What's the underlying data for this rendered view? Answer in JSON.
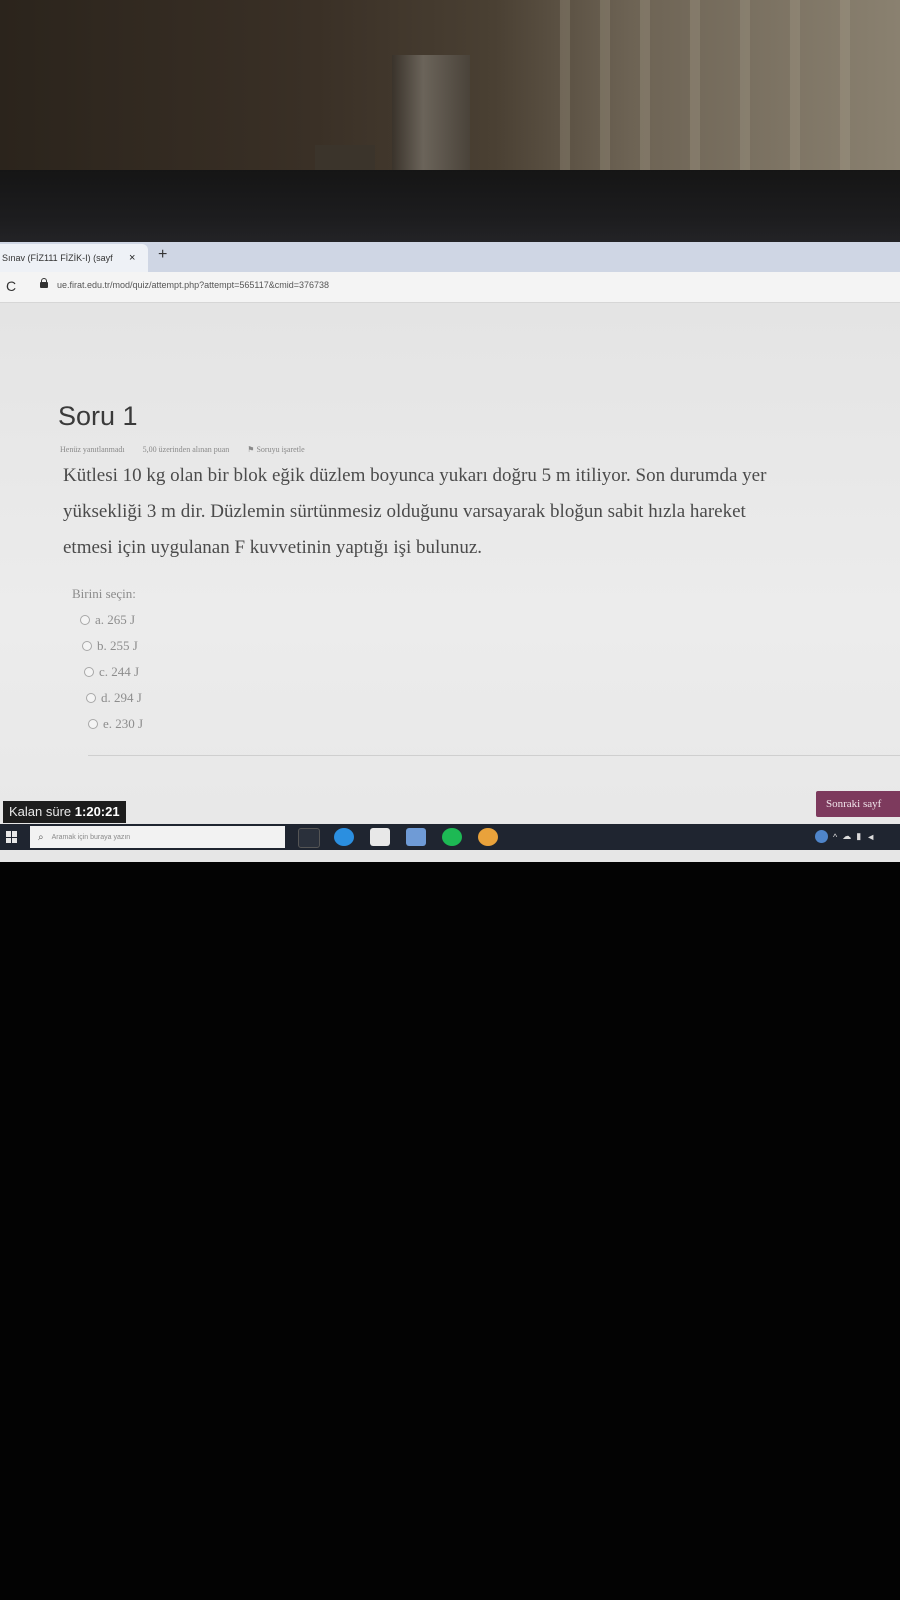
{
  "browser": {
    "tab_title": "Sınav (FİZ111 FİZİK-I) (sayf",
    "tab_close": "×",
    "new_tab": "+",
    "reload": "C",
    "url": "ue.firat.edu.tr/mod/quiz/attempt.php?attempt=565117&cmid=376738"
  },
  "question": {
    "heading": "Soru 1",
    "status": "Henüz yanıtlanmadı",
    "points": "5,00 üzerinden alınan puan",
    "flag": "Soruyu işaretle",
    "text_line1": "Kütlesi 10 kg olan bir blok eğik düzlem boyunca yukarı doğru 5 m itiliyor. Son durumda yer",
    "text_line2": "yüksekliği 3 m dir. Düzlemin sürtünmesiz olduğunu varsayarak bloğun sabit hızla hareket",
    "text_line3": "etmesi için uygulanan F kuvvetinin yaptığı işi bulunuz.",
    "choose_label": "Birini seçin:",
    "options": [
      {
        "label": "a. 265 J"
      },
      {
        "label": "b. 255 J"
      },
      {
        "label": "c. 244 J"
      },
      {
        "label": "d. 294 J"
      },
      {
        "label": "e. 230 J"
      }
    ]
  },
  "footer": {
    "timer_label": "Kalan süre",
    "timer_value": "1:20:21",
    "next_button": "Sonraki sayf"
  },
  "taskbar": {
    "search_placeholder": "Aramak için buraya yazın",
    "icons": [
      "task-view-icon",
      "edge-icon",
      "store-icon",
      "mail-icon",
      "spotify-icon",
      "chrome-icon"
    ],
    "icon_colors": [
      "#d8d8d8",
      "#2b8fe0",
      "#e8e8e8",
      "#6f9bd6",
      "#1db954",
      "#e9a23b"
    ]
  }
}
